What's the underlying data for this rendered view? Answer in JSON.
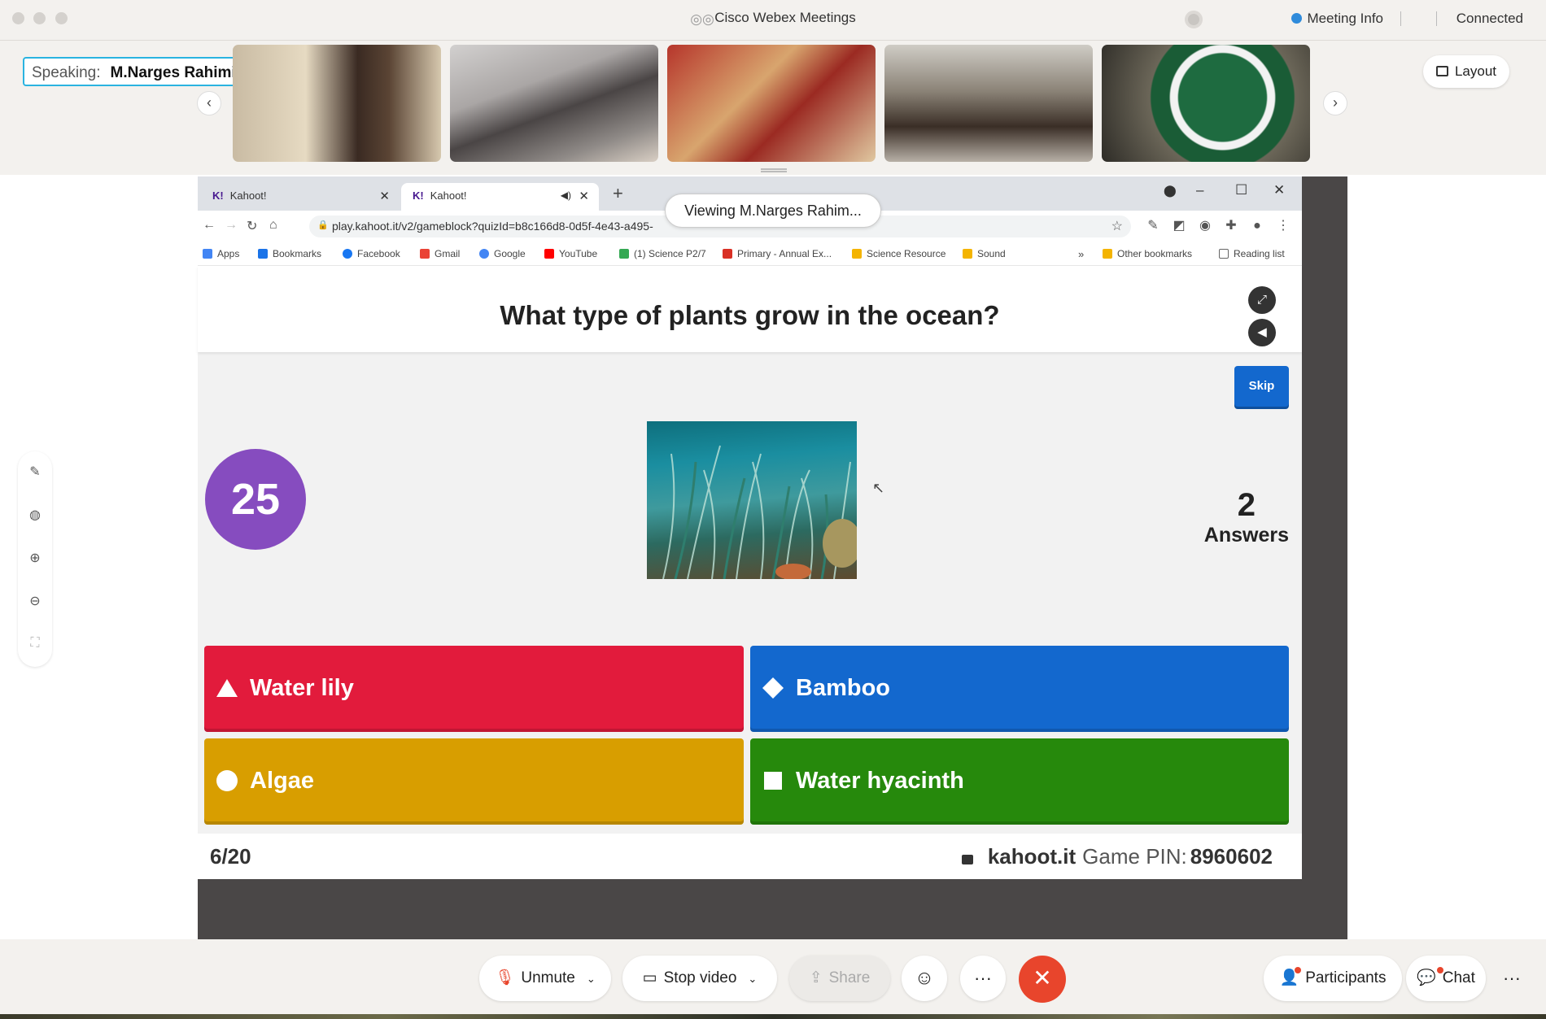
{
  "window": {
    "title": "Cisco Webex Meetings",
    "meeting_info": "Meeting Info",
    "status": "Connected"
  },
  "video_strip": {
    "speaking_label": "Speaking:",
    "speaker_name": "M.Narges Rahimiparvar (C...",
    "layout_label": "Layout"
  },
  "viewing_banner": "Viewing M.Narges Rahim...",
  "browser": {
    "tabs": [
      {
        "icon": "K!",
        "title": "Kahoot!"
      },
      {
        "icon": "K!",
        "title": "Kahoot!"
      }
    ],
    "url": "play.kahoot.it/v2/gameblock?quizId=b8c166d8-0d5f-4e43-a495-",
    "bookmarks": [
      {
        "label": "Apps",
        "color": "#4285f4"
      },
      {
        "label": "Bookmarks",
        "color": "#1a73e8"
      },
      {
        "label": "Facebook",
        "color": "#1877f2"
      },
      {
        "label": "Gmail",
        "color": "#ea4335"
      },
      {
        "label": "Google",
        "color": "#4285f4"
      },
      {
        "label": "YouTube",
        "color": "#ff0000"
      },
      {
        "label": "(1) Science P2/7",
        "color": "#34a853"
      },
      {
        "label": "Primary - Annual Ex...",
        "color": "#d93025"
      },
      {
        "label": "Science Resource",
        "color": "#f4b400"
      },
      {
        "label": "Sound",
        "color": "#f4b400"
      }
    ],
    "overflow": "»",
    "other_bookmarks": "Other bookmarks",
    "reading_list": "Reading list"
  },
  "kahoot": {
    "question": "What type of plants grow in the ocean?",
    "skip_label": "Skip",
    "timer": "25",
    "answers_count": "2",
    "answers_label": "Answers",
    "answers": [
      {
        "shape": "triangle",
        "text": "Water lily",
        "color": "#e21b3c"
      },
      {
        "shape": "diamond",
        "text": "Bamboo",
        "color": "#1368ce"
      },
      {
        "shape": "circle",
        "text": "Algae",
        "color": "#d89e00"
      },
      {
        "shape": "square",
        "text": "Water hyacinth",
        "color": "#26890c"
      }
    ],
    "progress": "6/20",
    "site": "kahoot.it",
    "pin_label": "Game PIN:",
    "pin": "8960602"
  },
  "controls": {
    "unmute": "Unmute",
    "stop_video": "Stop video",
    "share": "Share",
    "participants": "Participants",
    "chat": "Chat"
  }
}
